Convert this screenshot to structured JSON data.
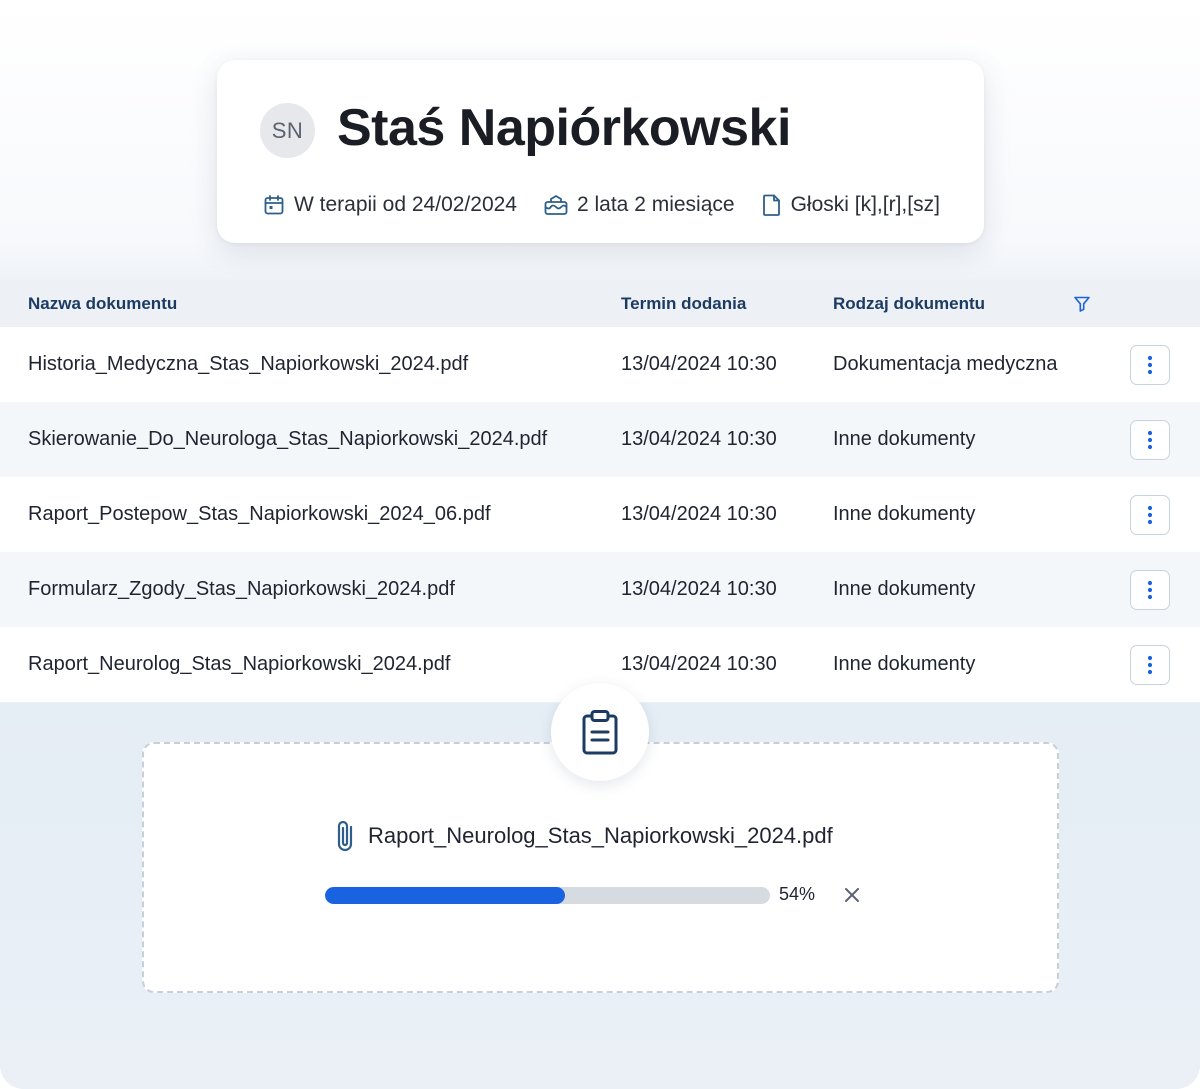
{
  "patient": {
    "initials": "SN",
    "name": "Staś Napiórkowski",
    "therapy_since": "W terapii od 24/02/2024",
    "age": "2 lata 2 miesiące",
    "sounds": "Głoski [k],[r],[sz]"
  },
  "table": {
    "columns": {
      "name": "Nazwa dokumentu",
      "date": "Termin dodania",
      "type": "Rodzaj dokumentu"
    },
    "rows": [
      {
        "name": "Historia_Medyczna_Stas_Napiorkowski_2024.pdf",
        "date": "13/04/2024 10:30",
        "type": "Dokumentacja medyczna"
      },
      {
        "name": "Skierowanie_Do_Neurologa_Stas_Napiorkowski_2024.pdf",
        "date": "13/04/2024 10:30",
        "type": "Inne dokumenty"
      },
      {
        "name": "Raport_Postepow_Stas_Napiorkowski_2024_06.pdf",
        "date": "13/04/2024 10:30",
        "type": "Inne dokumenty"
      },
      {
        "name": "Formularz_Zgody_Stas_Napiorkowski_2024.pdf",
        "date": "13/04/2024 10:30",
        "type": "Inne dokumenty"
      },
      {
        "name": "Raport_Neurolog_Stas_Napiorkowski_2024.pdf",
        "date": "13/04/2024 10:30",
        "type": "Inne dokumenty"
      }
    ]
  },
  "upload": {
    "file_name": "Raport_Neurolog_Stas_Napiorkowski_2024.pdf",
    "progress_percent": 54,
    "progress_label": "54%"
  },
  "icons": {
    "calendar": "calendar-icon",
    "cake": "cake-icon",
    "document": "document-icon",
    "filter": "filter-icon",
    "more": "more-vertical-icon",
    "clipboard": "clipboard-icon",
    "paperclip": "paperclip-icon",
    "close": "close-icon"
  },
  "colors": {
    "accent": "#1a63e0",
    "header_text": "#1c3b63",
    "filter_icon": "#1a63e0"
  }
}
